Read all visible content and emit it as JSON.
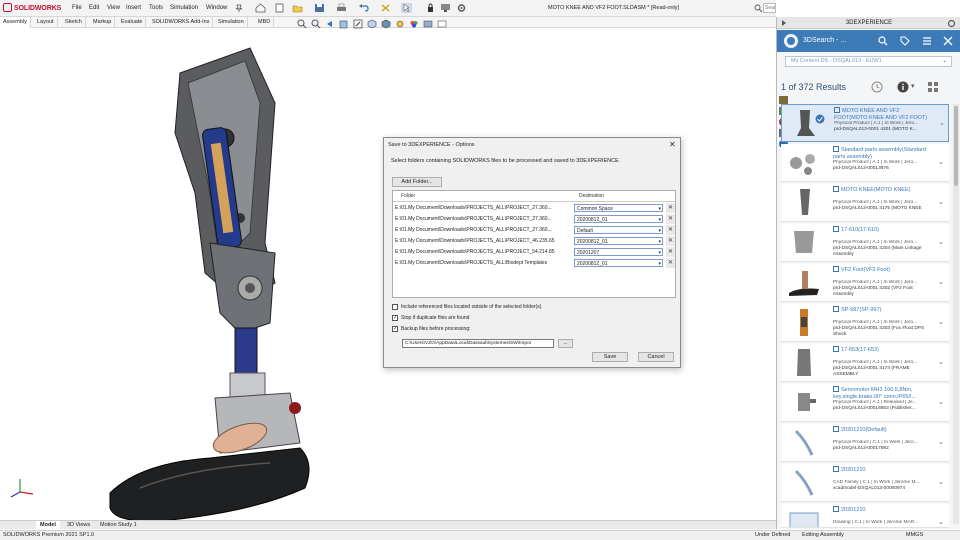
{
  "app": {
    "logo_text": "SOLIDWORKS",
    "document_title": "MOTO KNEE AND VF2 FOOT.SLDASM * [Read-only]"
  },
  "menu": [
    "File",
    "Edit",
    "View",
    "Insert",
    "Tools",
    "Simulation",
    "Window"
  ],
  "search": {
    "placeholder": "Search Commands"
  },
  "command_tabs": [
    "Assembly",
    "Layout",
    "Sketch",
    "Markup",
    "Evaluate",
    "SOLIDWORKS Add-Ins",
    "Simulation",
    "MBD"
  ],
  "bottom_tabs": [
    "Model",
    "3D Views",
    "Motion Study 1"
  ],
  "status_bar": {
    "version": "SOLIDWORKS Premium 2021 SP1.0",
    "state": "Under Defined",
    "mode": "Editing Assembly",
    "units": "MMGS"
  },
  "dialog": {
    "title": "Save to 3DEXPERIENCE - Options",
    "instructions": "Select folders containing SOLIDWORKS files to be processed and saved to 3DEXPERIENCE",
    "add_folder_label": "Add Folder...",
    "col_folder": "Folder",
    "col_destination": "Destination",
    "rows": [
      {
        "folder": "E:\\01.My Document\\Downloads\\PROJECTS_ALL\\PROJECT_27.360...",
        "destination": "Common Space"
      },
      {
        "folder": "E:\\01.My Document\\Downloads\\PROJECTS_ALL\\PROJECT_27.360...",
        "destination": "20200812_01"
      },
      {
        "folder": "E:\\01.My Document\\Downloads\\PROJECTS_ALL\\PROJECT_27.360...",
        "destination": "Default"
      },
      {
        "folder": "E:\\01.My Document\\Downloads\\PROJECTS_ALL\\PROJECT_46.235.65",
        "destination": "20200812_01"
      },
      {
        "folder": "E:\\01.My Document\\Downloads\\PROJECTS_ALL\\PROJECT_54.214.85",
        "destination": "20201207"
      },
      {
        "folder": "E:\\01.My Document\\Downloads\\PROJECTS_ALL\\Biodept Templates",
        "destination": "20200812_01"
      }
    ],
    "opt_include_ref": "Include referenced files located outside of the selected folder(s)",
    "opt_stop_dup": "Stop if duplicate files are found",
    "opt_backup": "Backup files before processing:",
    "checks": [
      false,
      true,
      true
    ],
    "backup_path": "C:\\Users\\VZO\\AppData\\Local\\DassaultSystemes\\SW\\Impor",
    "browse_label": "...",
    "save_label": "Save",
    "cancel_label": "Cancel"
  },
  "panel": {
    "title": "3DEXPERIENCE",
    "app_name": "3DSearch - ...",
    "content_selector": "My Content DS - DSQAL013 - EUW1",
    "results_of": "1  of  372  Results",
    "results": [
      {
        "title": "MOTO KNEE AND VF2 FOOT(MOTO KNEE AND VF2 FOOT)",
        "meta1": "Physical Product | A.1 | In Work | Jero...",
        "meta2": "prd-DSQAL013-0001 4201 (MOTO K...",
        "selected": true
      },
      {
        "title": "Standard parts assembly(Standard parts assembly)",
        "meta1": "Physical Product | A.1 | In Work | Jero...",
        "meta2": "prd-DSQAL013-00013876",
        "selected": false
      },
      {
        "title": "MOTO KNEE(MOTO KNEE)",
        "meta1": "Physical Product | A.1 | In Work | Jero...",
        "meta2": "prd-DSQAL013-0001 4175 (MOTO KNEE",
        "selected": false
      },
      {
        "title": "17-610(17-610)",
        "meta1": "Physical Product | A.1 | In Work | Jero...",
        "meta2": "prd-DSQAL013-0001 4204 (Main Linkage Assembly",
        "selected": false
      },
      {
        "title": "VF2 Foot(VF2 Foot)",
        "meta1": "Physical Product | A.1 | In Work | Jero...",
        "meta2": "prd-DSQAL013-0001 4202 (VF2 Foot Assembly",
        "selected": false
      },
      {
        "title": "SP-997(SP-997)",
        "meta1": "Physical Product | A.1 | In Work | Jero...",
        "meta2": "prd-DSQAL013-0001 4203 (Fox Float DPS Shock",
        "selected": false
      },
      {
        "title": "17-653(17-653)",
        "meta1": "Physical Product | A.1 | In Work | Jero...",
        "meta2": "prd-DSQAL013-0001 4174 (FRAME ASSEMBLY",
        "selected": false
      },
      {
        "title": "Servomotor MH3 100.5,8Nm, key,single,brake,90° conn,IP65/I...",
        "meta1": "Physical Product | A.1 | Released | Je...",
        "meta2": "prd-DSQAL013-00016853 (Publisher...",
        "selected": false
      },
      {
        "title": "20201210(Default)",
        "meta1": "Physical Product | C.1 | In Work | Jero...",
        "meta2": "prd-DSQAL013-00017892",
        "selected": false
      },
      {
        "title": "20201210",
        "meta1": "CAD Family | C.1 | In Work | Jerome M...",
        "meta2": "xcadmodel-DSQAL013-00000974",
        "selected": false
      },
      {
        "title": "20201210",
        "meta1": "Drawing | C.1 | In Work | Jerome MAR...",
        "meta2": "",
        "selected": false
      }
    ]
  },
  "colors": {
    "accent": "#3d7ab8",
    "brand_red": "#c8102e",
    "link_blue": "#3b77b8"
  }
}
